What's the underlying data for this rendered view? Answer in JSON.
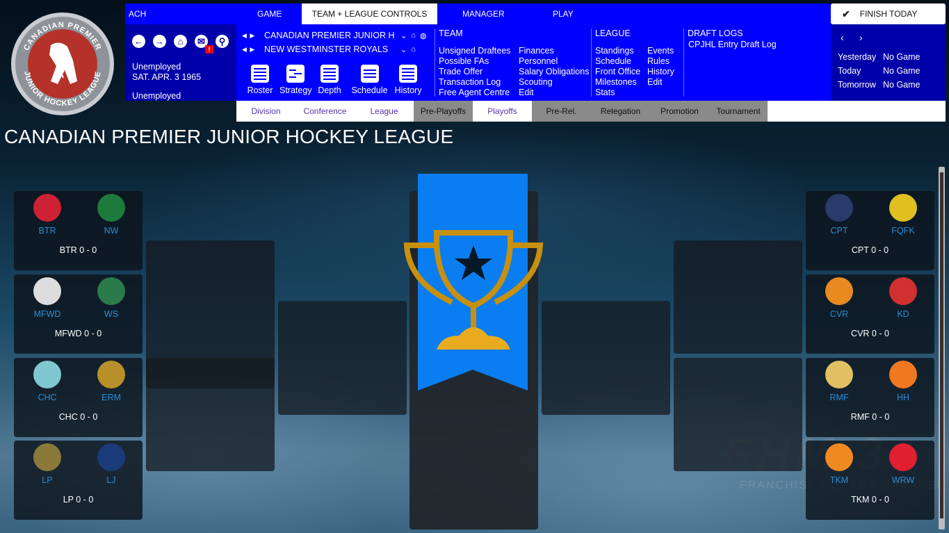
{
  "logo": {
    "top_text": "CANADIAN PREMIER",
    "bottom_text": "JUNIOR HOCKEY LEAGUE"
  },
  "topbar": {
    "left_label": "ACH",
    "tabs": [
      {
        "label": "GAME",
        "active": false
      },
      {
        "label": "TEAM + LEAGUE CONTROLS",
        "active": true
      },
      {
        "label": "MANAGER",
        "active": false
      },
      {
        "label": "PLAY",
        "active": false
      }
    ],
    "finish_button": "FINISH TODAY"
  },
  "navleft": {
    "icons": [
      "back-icon",
      "forward-icon",
      "home-icon",
      "mail-icon",
      "search-icon"
    ],
    "mail_badge": "!",
    "status1": "Unemployed",
    "date": "SAT. APR. 3 1965",
    "status2": "Unemployed"
  },
  "selectors": {
    "league": "CANADIAN PREMIER JUNIOR H",
    "team": "NEW WESTMINSTER ROYALS"
  },
  "tools": [
    "Roster",
    "Strategy",
    "Depth",
    "Schedule",
    "History"
  ],
  "team_menu": {
    "heading": "TEAM",
    "col1": [
      "Unsigned Draftees",
      "Possible FAs",
      "Trade Offer",
      "Transaction Log",
      "Free Agent Centre"
    ],
    "col2": [
      "Finances",
      "Personnel",
      "Salary Obligations",
      "Scouting",
      "Edit"
    ]
  },
  "league_menu": {
    "heading": "LEAGUE",
    "col1": [
      "Standings",
      "Schedule",
      "Front Office",
      "Milestones",
      "Stats"
    ],
    "col2": [
      "Events",
      "Rules",
      "History",
      "Edit"
    ]
  },
  "draft_menu": {
    "heading": "DRAFT LOGS",
    "items": [
      "CPJHL Entry Draft Log"
    ]
  },
  "schedule_panel": {
    "rows": [
      {
        "day": "Yesterday",
        "value": "No Game"
      },
      {
        "day": "Today",
        "value": "No Game"
      },
      {
        "day": "Tomorrow",
        "value": "No Game"
      }
    ]
  },
  "subtabs": [
    {
      "label": "Division",
      "style": "white"
    },
    {
      "label": "Conference",
      "style": "white"
    },
    {
      "label": "League",
      "style": "white"
    },
    {
      "label": "Pre-Playoffs",
      "style": "gray"
    },
    {
      "label": "Playoffs",
      "style": "white"
    },
    {
      "label": "Pre-Rel.",
      "style": "gray"
    },
    {
      "label": "Relegation",
      "style": "gray"
    },
    {
      "label": "Promotion",
      "style": "gray"
    },
    {
      "label": "Tournament",
      "style": "gray"
    }
  ],
  "page_title": "CANADIAN PREMIER JUNIOR HOCKEY LEAGUE",
  "bracket": {
    "left": [
      {
        "home": "BTR",
        "away": "NW",
        "score": "BTR 0 - 0",
        "home_color": "#cc2233",
        "away_color": "#1e7a3a"
      },
      {
        "home": "MFWD",
        "away": "WS",
        "score": "MFWD 0 - 0",
        "home_color": "#dddddd",
        "away_color": "#2a7a4a"
      },
      {
        "home": "CHC",
        "away": "ERM",
        "score": "CHC 0 - 0",
        "home_color": "#7fc8d0",
        "away_color": "#b8902a"
      },
      {
        "home": "LP",
        "away": "LJ",
        "score": "LP 0 - 0",
        "home_color": "#8a7a3a",
        "away_color": "#1a3a7a"
      }
    ],
    "right": [
      {
        "home": "CPT",
        "away": "FQFK",
        "score": "CPT 0 - 0",
        "home_color": "#2a3a6a",
        "away_color": "#e0c020"
      },
      {
        "home": "CVR",
        "away": "KD",
        "score": "CVR 0 - 0",
        "home_color": "#e88a20",
        "away_color": "#d03030"
      },
      {
        "home": "RMF",
        "away": "HH",
        "score": "RMF 0 - 0",
        "home_color": "#e0c060",
        "away_color": "#f07820"
      },
      {
        "home": "TKM",
        "away": "WRW",
        "score": "TKM 0 - 0",
        "home_color": "#f08a20",
        "away_color": "#e02030"
      }
    ]
  },
  "watermark": {
    "big": "FHM 3",
    "small": "FRANCHISE HOCKEY MANAGER"
  }
}
